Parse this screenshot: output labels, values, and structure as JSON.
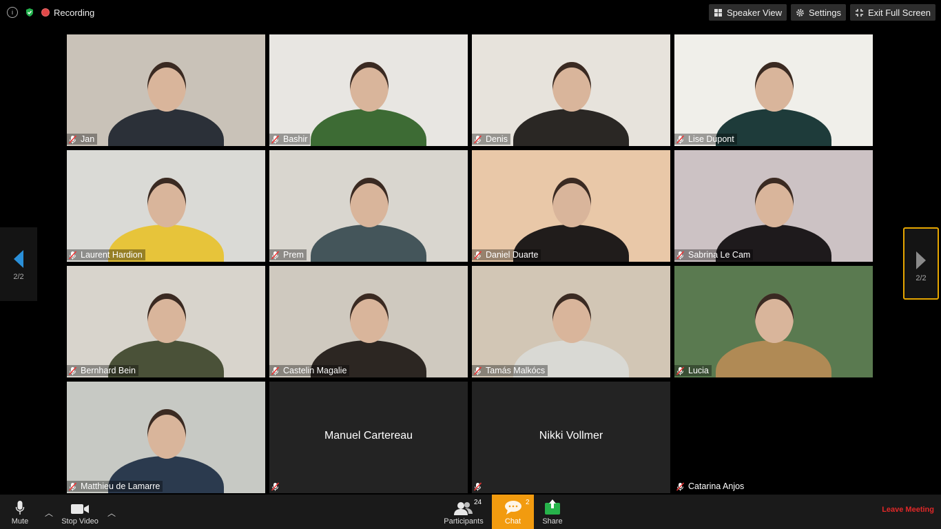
{
  "top_bar": {
    "info_icon": "info-icon",
    "shield_icon": "shield-check-icon",
    "recording_label": "Recording",
    "speaker_view_label": "Speaker View",
    "settings_label": "Settings",
    "exit_fullscreen_label": "Exit Full Screen"
  },
  "participants_grid": [
    {
      "name": "Jan",
      "has_video": true,
      "bg": "#c9c2b8",
      "shirt": "#2b3038"
    },
    {
      "name": "Bashir",
      "has_video": true,
      "bg": "#e8e6e2",
      "shirt": "#3d6b34"
    },
    {
      "name": "Denis",
      "has_video": true,
      "bg": "#e7e3dc",
      "shirt": "#2a2724"
    },
    {
      "name": "Lise Dupont",
      "has_video": true,
      "bg": "#f0efea",
      "shirt": "#1e3b3a"
    },
    {
      "name": "Laurent Hardion",
      "has_video": true,
      "bg": "#dadad6",
      "shirt": "#e7c43a"
    },
    {
      "name": "Prem",
      "has_video": true,
      "bg": "#d9d6cf",
      "shirt": "#44555a"
    },
    {
      "name": "Daniel Duarte",
      "has_video": true,
      "bg": "#e9c8a8",
      "shirt": "#201c1b"
    },
    {
      "name": "Sabrina Le Cam",
      "has_video": true,
      "bg": "#ccc2c4",
      "shirt": "#1e1a1c"
    },
    {
      "name": "Bernhard Bein",
      "has_video": true,
      "bg": "#d8d4cc",
      "shirt": "#4a5138"
    },
    {
      "name": "Castelin Magalie",
      "has_video": true,
      "bg": "#cfc9bf",
      "shirt": "#2c2622"
    },
    {
      "name": "Tamás Malkócs",
      "has_video": true,
      "bg": "#d2c6b5",
      "shirt": "#d9d9d4"
    },
    {
      "name": "Lucia",
      "has_video": true,
      "bg": "#5a7a50",
      "shirt": "#b08a55"
    },
    {
      "name": "Matthieu de Lamarre",
      "has_video": true,
      "bg": "#c7c9c4",
      "shirt": "#2b3a4e"
    },
    {
      "name": "Manuel Cartereau",
      "has_video": false,
      "bg": "#232323",
      "shirt": ""
    },
    {
      "name": "Nikki Vollmer",
      "has_video": false,
      "bg": "#232323",
      "shirt": ""
    },
    {
      "name": "Catarina Anjos",
      "has_video": false,
      "bg": "#000000",
      "shirt": ""
    }
  ],
  "pagination": {
    "left_page": "2/2",
    "right_page": "2/2"
  },
  "bottom_bar": {
    "mute_label": "Mute",
    "stop_video_label": "Stop Video",
    "participants_label": "Participants",
    "participants_count": "24",
    "chat_label": "Chat",
    "chat_count": "2",
    "share_label": "Share",
    "leave_label": "Leave Meeting"
  },
  "colors": {
    "accent_orange": "#f29b0f",
    "nav_highlight": "#e6a600",
    "leave_red": "#e02828",
    "share_green": "#27b34b",
    "nav_arrow_blue": "#2a8fd8"
  }
}
